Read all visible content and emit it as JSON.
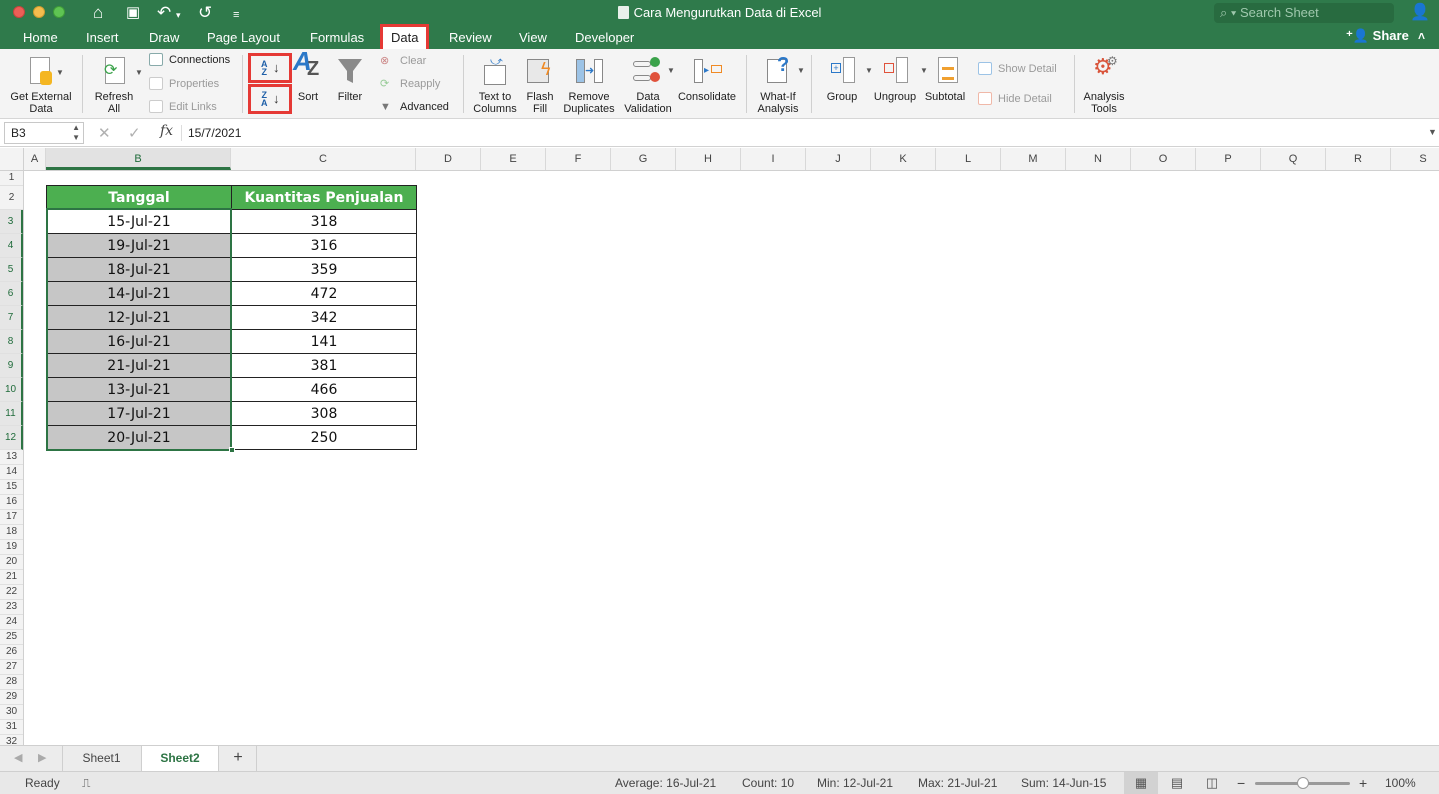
{
  "window": {
    "title": "Cara Mengurutkan Data di Excel",
    "search_placeholder": "Search Sheet",
    "share_label": "Share"
  },
  "menu_tabs": [
    {
      "label": "Home",
      "active": false
    },
    {
      "label": "Insert",
      "active": false
    },
    {
      "label": "Draw",
      "active": false
    },
    {
      "label": "Page Layout",
      "active": false
    },
    {
      "label": "Formulas",
      "active": false
    },
    {
      "label": "Data",
      "active": true
    },
    {
      "label": "Review",
      "active": false
    },
    {
      "label": "View",
      "active": false
    },
    {
      "label": "Developer",
      "active": false
    }
  ],
  "ribbon": {
    "get_external_data": "Get External Data",
    "get_external_data_l1": "Get External",
    "get_external_data_l2": "Data",
    "refresh_l1": "Refresh",
    "refresh_l2": "All",
    "connections": "Connections",
    "properties": "Properties",
    "edit_links": "Edit Links",
    "sort_az_icon": "sort-ascending-a-z",
    "sort_za_icon": "sort-descending-z-a",
    "sort": "Sort",
    "filter": "Filter",
    "clear": "Clear",
    "reapply": "Reapply",
    "advanced": "Advanced",
    "text_to_columns_l1": "Text to",
    "text_to_columns_l2": "Columns",
    "flash_fill_l1": "Flash",
    "flash_fill_l2": "Fill",
    "remove_duplicates_l1": "Remove",
    "remove_duplicates_l2": "Duplicates",
    "data_validation_l1": "Data",
    "data_validation_l2": "Validation",
    "consolidate": "Consolidate",
    "what_if_l1": "What-If",
    "what_if_l2": "Analysis",
    "group": "Group",
    "ungroup": "Ungroup",
    "subtotal": "Subtotal",
    "show_detail": "Show Detail",
    "hide_detail": "Hide Detail",
    "analysis_tools_l1": "Analysis",
    "analysis_tools_l2": "Tools"
  },
  "formula_bar": {
    "name_box": "B3",
    "fx": "fx",
    "value": "15/7/2021"
  },
  "columns": [
    "A",
    "B",
    "C",
    "D",
    "E",
    "F",
    "G",
    "H",
    "I",
    "J",
    "K",
    "L",
    "M",
    "N",
    "O",
    "P",
    "Q",
    "R",
    "S"
  ],
  "rows": [
    "1",
    "2",
    "3",
    "4",
    "5",
    "6",
    "7",
    "8",
    "9",
    "10",
    "11",
    "12",
    "13",
    "14",
    "15",
    "16",
    "17",
    "18",
    "19",
    "20",
    "21",
    "22",
    "23",
    "24",
    "25",
    "26",
    "27",
    "28",
    "29",
    "30",
    "31",
    "32"
  ],
  "table": {
    "headers": [
      "Tanggal",
      "Kuantitas Penjualan"
    ],
    "rows": [
      {
        "date": "15-Jul-21",
        "qty": "318"
      },
      {
        "date": "19-Jul-21",
        "qty": "316"
      },
      {
        "date": "18-Jul-21",
        "qty": "359"
      },
      {
        "date": "14-Jul-21",
        "qty": "472"
      },
      {
        "date": "12-Jul-21",
        "qty": "342"
      },
      {
        "date": "16-Jul-21",
        "qty": "141"
      },
      {
        "date": "21-Jul-21",
        "qty": "381"
      },
      {
        "date": "13-Jul-21",
        "qty": "466"
      },
      {
        "date": "17-Jul-21",
        "qty": "308"
      },
      {
        "date": "20-Jul-21",
        "qty": "250"
      }
    ]
  },
  "sheets": [
    {
      "label": "Sheet1",
      "active": false
    },
    {
      "label": "Sheet2",
      "active": true
    }
  ],
  "add_sheet": "+",
  "status": {
    "mode": "Ready",
    "average": "Average: 16-Jul-21",
    "count": "Count: 10",
    "min": "Min: 12-Jul-21",
    "max": "Max: 21-Jul-21",
    "sum": "Sum: 14-Jun-15",
    "zoom": "100%",
    "zoom_minus": "−",
    "zoom_plus": "+"
  },
  "colors": {
    "title_bar": "#2f7a4b",
    "header_fill": "#4caf50",
    "selected_fill": "#c6c6c6",
    "highlight_box": "#e53935"
  }
}
